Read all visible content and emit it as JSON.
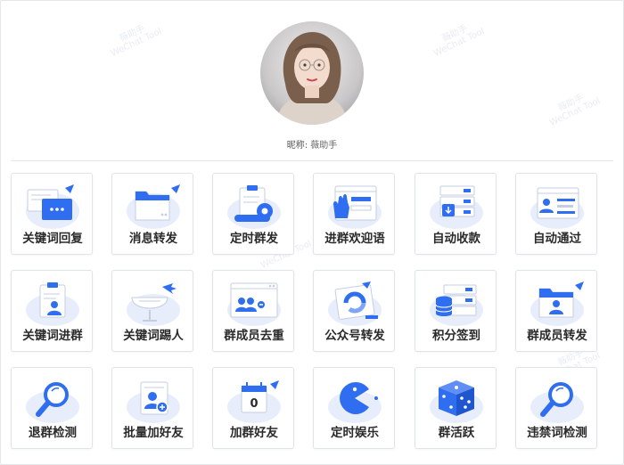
{
  "profile": {
    "nickname_label": "昵称:",
    "nickname_value": "薇助手"
  },
  "watermark_text": "薇助手\nWeChat Tool",
  "features": [
    {
      "label": "关键词回复",
      "icon": "chat-bubble-icon"
    },
    {
      "label": "消息转发",
      "icon": "folder-send-icon"
    },
    {
      "label": "定时群发",
      "icon": "clipboard-gear-icon"
    },
    {
      "label": "进群欢迎语",
      "icon": "hand-wave-window-icon"
    },
    {
      "label": "自动收款",
      "icon": "server-download-icon"
    },
    {
      "label": "自动通过",
      "icon": "user-window-icon"
    },
    {
      "label": "关键词进群",
      "icon": "clipboard-user-icon"
    },
    {
      "label": "关键词踢人",
      "icon": "satellite-dish-icon"
    },
    {
      "label": "群成员去重",
      "icon": "group-window-icon"
    },
    {
      "label": "公众号转发",
      "icon": "official-account-icon"
    },
    {
      "label": "积分签到",
      "icon": "database-checklist-icon"
    },
    {
      "label": "群成员转发",
      "icon": "folder-user-icon"
    },
    {
      "label": "退群检测",
      "icon": "magnifier-icon"
    },
    {
      "label": "批量加好友",
      "icon": "add-contact-icon"
    },
    {
      "label": "加群好友",
      "icon": "calendar-icon"
    },
    {
      "label": "定时娱乐",
      "icon": "pacman-icon"
    },
    {
      "label": "群活跃",
      "icon": "dice-icon"
    },
    {
      "label": "违禁词检测",
      "icon": "magnifier-icon"
    }
  ],
  "colors": {
    "accent": "#2f6ef0",
    "blob": "#e8edfb"
  }
}
